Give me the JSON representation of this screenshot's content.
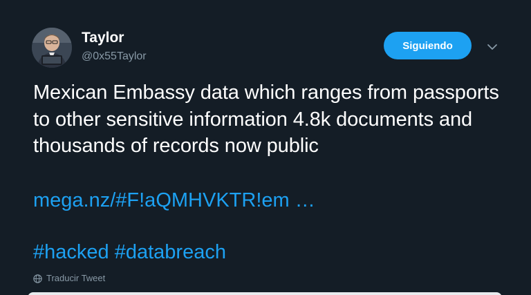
{
  "tweet": {
    "author": {
      "display_name": "Taylor",
      "handle": "@0x55Taylor",
      "avatar_icon": "user-avatar"
    },
    "follow_button_label": "Siguiendo",
    "menu_icon": "chevron-down-icon",
    "text": "Mexican Embassy data which ranges from passports to other sensitive information 4.8k documents and thousands of records now public",
    "link": "mega.nz/#F!aQMHVKTR!em …",
    "hashtags": [
      "#hacked",
      "#databreach"
    ],
    "translate_label": "Traducir Tweet",
    "translate_icon": "globe-icon"
  },
  "colors": {
    "background": "#141d26",
    "accent": "#1da1f2",
    "text_primary": "#ffffff",
    "text_secondary": "#8899a6"
  }
}
